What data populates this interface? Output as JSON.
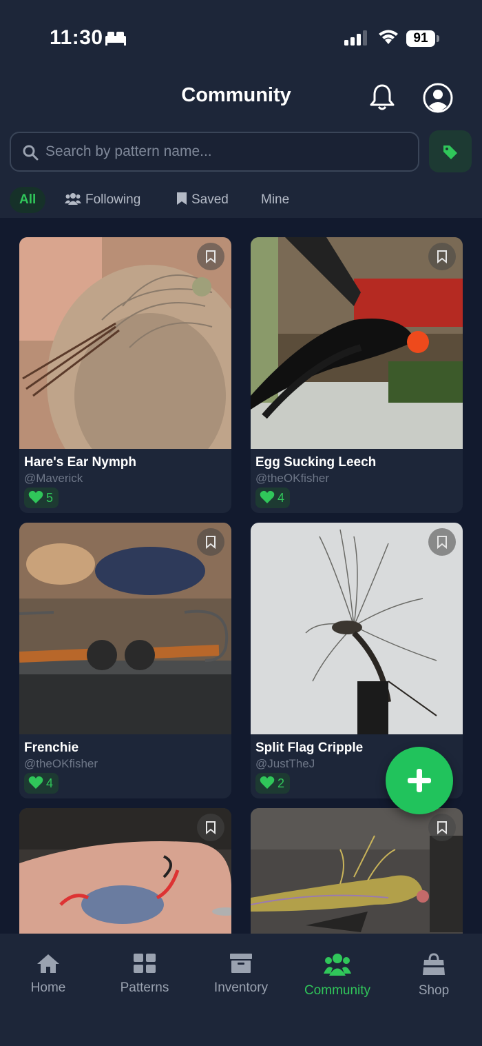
{
  "status_bar": {
    "time": "11:30",
    "battery": "91"
  },
  "header": {
    "title": "Community"
  },
  "search": {
    "placeholder": "Search by pattern name..."
  },
  "tabs": [
    {
      "label": "All",
      "active": true
    },
    {
      "label": "Following",
      "icon": "users-icon"
    },
    {
      "label": "Saved",
      "icon": "bookmark-icon"
    },
    {
      "label": "Mine"
    }
  ],
  "patterns": [
    {
      "title": "Hare's Ear Nymph",
      "author": "@Maverick",
      "likes": "5"
    },
    {
      "title": "Egg Sucking Leech",
      "author": "@theOKfisher",
      "likes": "4"
    },
    {
      "title": "Frenchie",
      "author": "@theOKfisher",
      "likes": "4"
    },
    {
      "title": "Split Flag Cripple",
      "author": "@JustTheJ",
      "likes": "2"
    }
  ],
  "nav": [
    {
      "label": "Home",
      "icon": "home-icon"
    },
    {
      "label": "Patterns",
      "icon": "grid-icon"
    },
    {
      "label": "Inventory",
      "icon": "archive-icon"
    },
    {
      "label": "Community",
      "icon": "users-icon",
      "active": true
    },
    {
      "label": "Shop",
      "icon": "shopping-bag-icon"
    }
  ],
  "colors": {
    "accent": "#30c65a",
    "background": "#121a2e",
    "surface": "#1d2639"
  }
}
